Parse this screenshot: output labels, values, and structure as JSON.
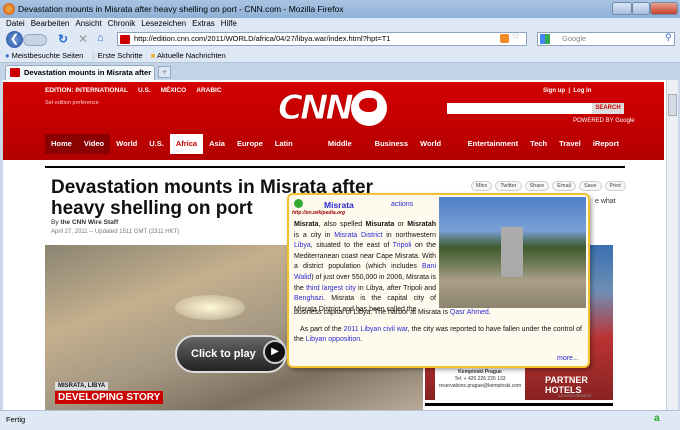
{
  "window": {
    "title": "Devastation mounts in Misrata after heavy shelling on port - CNN.com - Mozilla Firefox"
  },
  "menu": [
    "Datei",
    "Bearbeiten",
    "Ansicht",
    "Chronik",
    "Lesezeichen",
    "Extras",
    "Hilfe"
  ],
  "navbar": {
    "url": "http://edition.cnn.com/2011/WORLD/africa/04/27/libya.war/index.html?hpt=T1",
    "search_placeholder": "Google"
  },
  "bookmarks": [
    "Meistbesuchte Seiten",
    "Erste Schritte",
    "Aktuelle Nachrichten"
  ],
  "tab": {
    "label": "Devastation mounts in Misrata after ...",
    "new_tab": "+"
  },
  "cnn": {
    "edition": [
      "EDITION: INTERNATIONAL",
      "U.S.",
      "MÉXICO",
      "ARABIC"
    ],
    "set_pref": "Set edition preference",
    "logo": "CNN",
    "signup": "Sign up",
    "login": "Log in",
    "search_btn": "SEARCH",
    "powered": "POWERED BY Google",
    "nav": [
      "Home",
      "Video",
      "World",
      "U.S.",
      "Africa",
      "Asia",
      "Europe",
      "Latin America",
      "Middle East",
      "Business",
      "World Sport",
      "Entertainment",
      "Tech",
      "Travel",
      "iReport"
    ],
    "active_nav": "Africa"
  },
  "article": {
    "headline": "Devastation mounts in Misrata after heavy shelling on port",
    "by": "By ",
    "author": "the CNN Wire Staff",
    "date": "April 27, 2011 -- Updated 1511 GMT (2311 HKT)",
    "share": [
      "Mixx",
      "Twitter",
      "Share",
      "Email",
      "Save",
      "Print"
    ],
    "side_text": "e what",
    "video": {
      "play": "Click to play",
      "location": "MISRATA, LIBYA",
      "banner": "DEVELOPING STORY"
    }
  },
  "ad": {
    "name": "Kempinski Prague",
    "tel": "Tel: + 420 226 226 133",
    "email": "reservations.prague@kempinski.com",
    "hotels": "PARTNER HOTELS",
    "label": "ADVERTISEMENT"
  },
  "popup": {
    "title": "Misrata",
    "actions": "actions",
    "source": "http://en.wikipedia.org",
    "p1": [
      "Misrata",
      ", also spelled ",
      "Misurata",
      " or ",
      "Misratah",
      " is a city in ",
      "Misrata District",
      " in northwestern ",
      "Libya",
      ", situated to the east of ",
      "Tripoli",
      " on the Mediterranean coast near Cape Misrata. With a district population (which includes ",
      "Bani Walid",
      ") of just over 550,000 in 2006, Misrata is the ",
      "third largest city",
      " in Libya, after Tripoli and ",
      "Benghazi",
      ". Misrata is the capital city of Misrata District and has been called the"
    ],
    "p1b": [
      "business capital of Libya. The harbor at Misrata is ",
      "Qasr Ahmed",
      "."
    ],
    "p2": [
      "As part of the ",
      "2011 Libyan civil war",
      ", the city was reported to have fallen under the control of the ",
      "Libyan opposition",
      "."
    ],
    "more": "more..."
  },
  "status": {
    "text": "Fertig",
    "icon": "a"
  }
}
